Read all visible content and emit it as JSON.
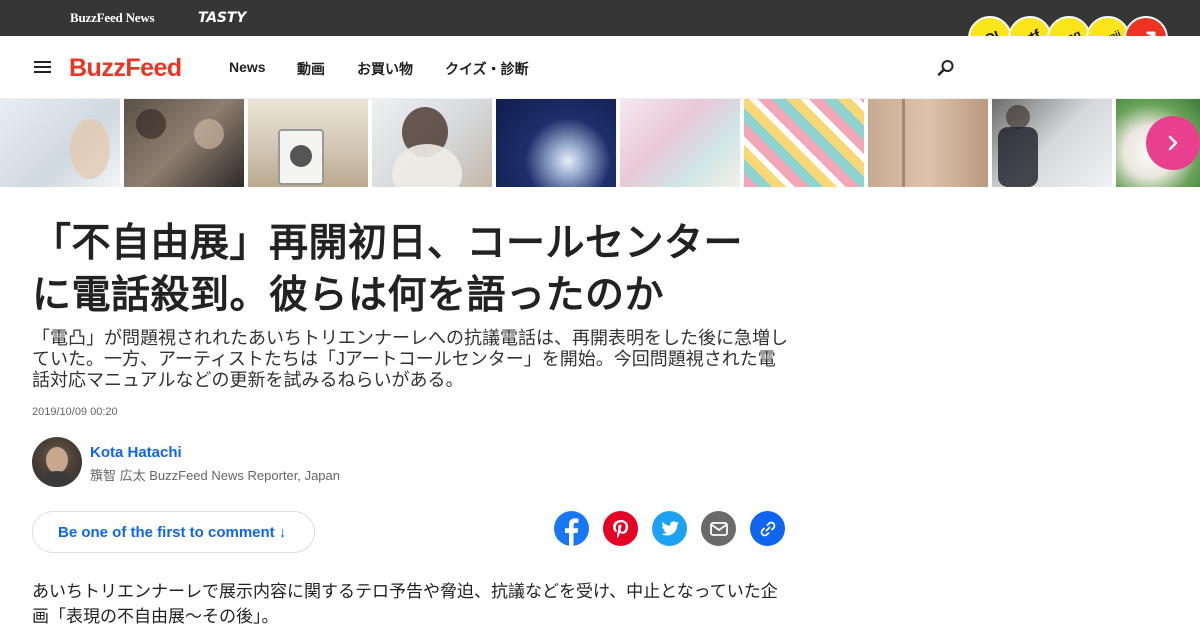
{
  "topbar": {
    "brand_news": "BuzzFeed News",
    "brand_tasty": "TASTY",
    "reactions": [
      "LOL",
      "wtf",
      "omg",
      "kawaii"
    ],
    "trending_icon": "trending-arrow-icon"
  },
  "nav": {
    "menu_icon": "hamburger-menu-icon",
    "logo": "BuzzFeed",
    "links": [
      "News",
      "動画",
      "お買い物",
      "クイズ・診断"
    ],
    "search_icon": "search-icon"
  },
  "strip": {
    "thumbnail_count": 10,
    "next_icon": "chevron-right-icon"
  },
  "article": {
    "headline": "「不自由展」再開初日、コールセンターに電話殺到。彼らは何を語ったのか",
    "dek": "「電凸」が問題視されれたあいちトリエンナーレへの抗議電話は、再開表明をした後に急増していた。一方、アーティストたちは「Jアートコールセンター」を開始。今回問題視された電話対応マニュアルなどの更新を試みるねらいがある。",
    "date": "2019/10/09 00:20",
    "author_name": "Kota Hatachi",
    "author_sub": "籏智 広太 BuzzFeed News Reporter, Japan",
    "comment_button": "Be one of the first to comment ↓",
    "body_first": "あいちトリエンナーレで展示内容に関するテロ予告や脅迫、抗議などを受け、中止となっていた企画「表現の不自由展〜その後」。"
  },
  "share": {
    "icons": [
      "facebook-icon",
      "pinterest-icon",
      "twitter-icon",
      "email-icon",
      "link-icon"
    ]
  },
  "colors": {
    "brand_red": "#ee3322",
    "link_blue": "#0f65ef",
    "reaction_yellow": "#f9e519",
    "next_pink": "#e8408e"
  }
}
